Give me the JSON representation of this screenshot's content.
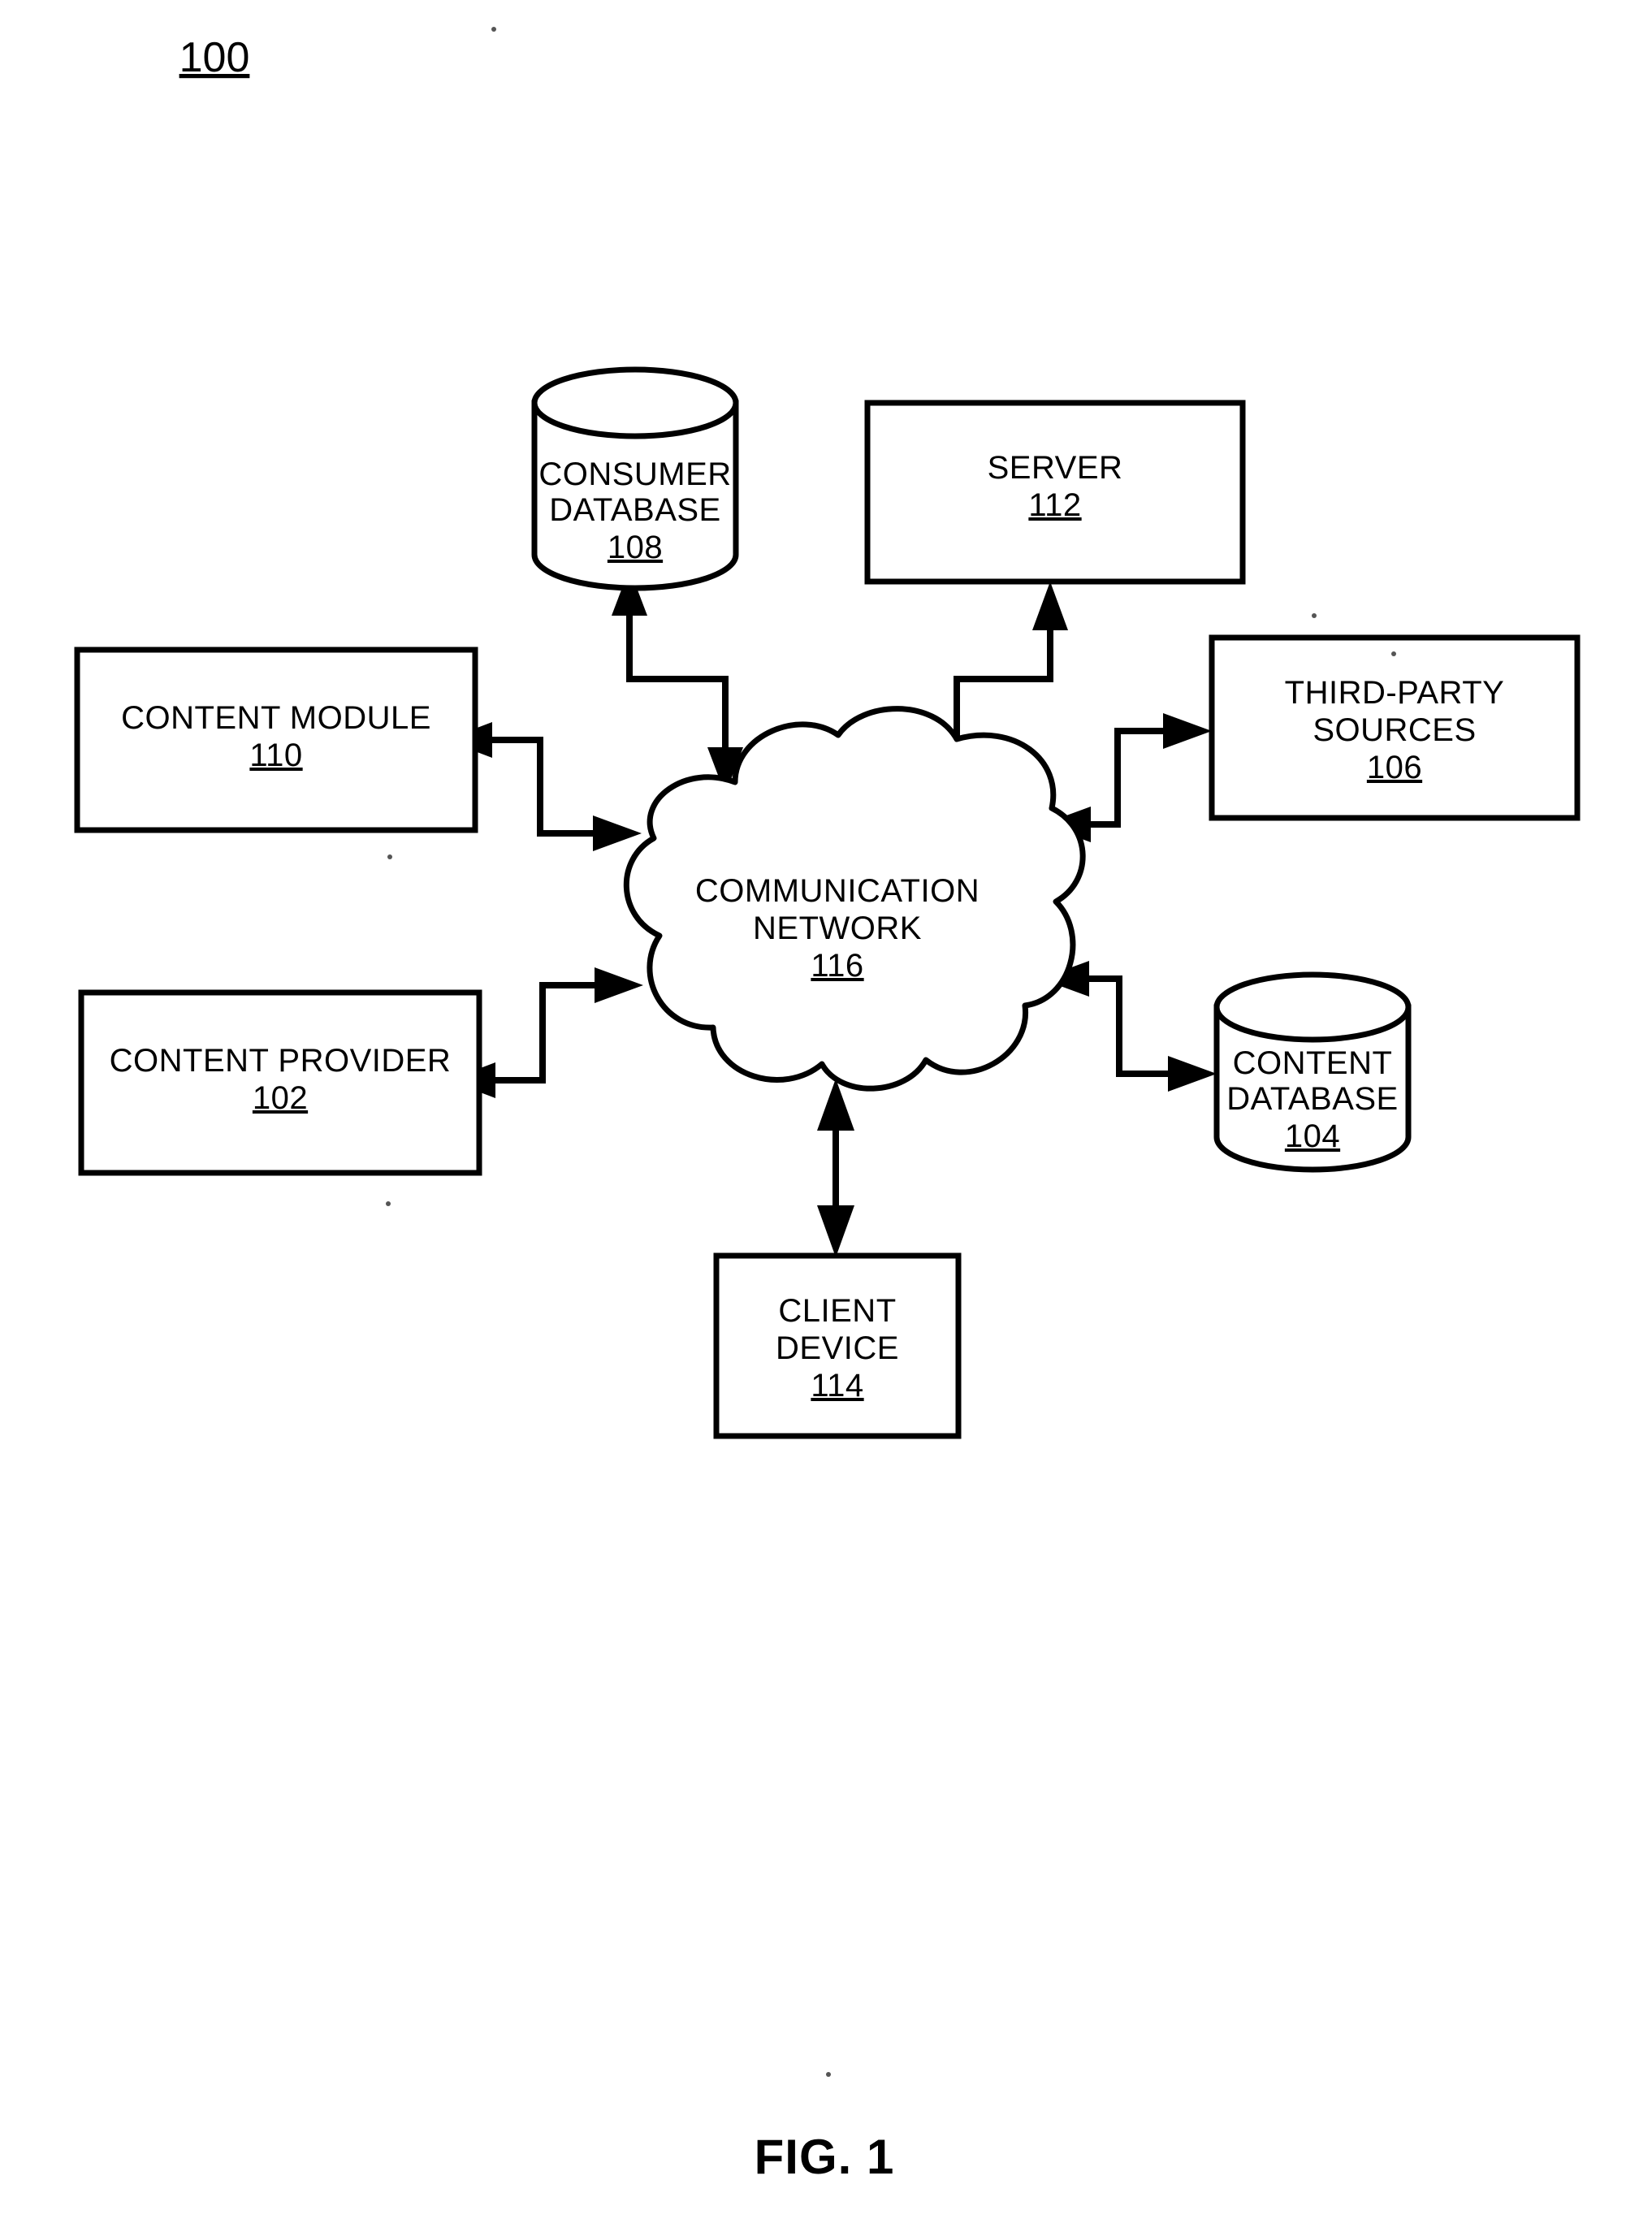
{
  "figure": {
    "number": "100",
    "caption": "FIG. 1",
    "type": "system-architecture-block-diagram"
  },
  "nodes": [
    {
      "id": "consumer-database",
      "shape": "cylinder",
      "lines": [
        "CONSUMER",
        "DATABASE"
      ],
      "ref": "108"
    },
    {
      "id": "server",
      "shape": "rectangle",
      "lines": [
        "SERVER"
      ],
      "ref": "112"
    },
    {
      "id": "content-module",
      "shape": "rectangle",
      "lines": [
        "CONTENT MODULE"
      ],
      "ref": "110"
    },
    {
      "id": "third-party-sources",
      "shape": "rectangle",
      "lines": [
        "THIRD-PARTY",
        "SOURCES"
      ],
      "ref": "106"
    },
    {
      "id": "communication-network",
      "shape": "cloud",
      "lines": [
        "COMMUNICATION",
        "NETWORK"
      ],
      "ref": "116"
    },
    {
      "id": "content-provider",
      "shape": "rectangle",
      "lines": [
        "CONTENT PROVIDER"
      ],
      "ref": "102"
    },
    {
      "id": "content-database",
      "shape": "cylinder",
      "lines": [
        "CONTENT",
        "DATABASE"
      ],
      "ref": "104"
    },
    {
      "id": "client-device",
      "shape": "rectangle",
      "lines": [
        "CLIENT",
        "DEVICE"
      ],
      "ref": "114"
    }
  ],
  "connections": [
    {
      "id": "net-consumerdb",
      "from": "communication-network",
      "to": "consumer-database",
      "style": "bidirectional-elbow"
    },
    {
      "id": "net-server",
      "from": "communication-network",
      "to": "server",
      "style": "bidirectional-elbow"
    },
    {
      "id": "net-contentmodule",
      "from": "communication-network",
      "to": "content-module",
      "style": "bidirectional-elbow"
    },
    {
      "id": "net-thirdparty",
      "from": "communication-network",
      "to": "third-party-sources",
      "style": "bidirectional-elbow"
    },
    {
      "id": "net-contentprovider",
      "from": "communication-network",
      "to": "content-provider",
      "style": "bidirectional-elbow"
    },
    {
      "id": "net-contentdb",
      "from": "communication-network",
      "to": "content-database",
      "style": "bidirectional-elbow"
    },
    {
      "id": "net-clientdevice",
      "from": "communication-network",
      "to": "client-device",
      "style": "double-headed-line"
    }
  ],
  "colors": {
    "ink": "#000000",
    "paper": "#ffffff"
  }
}
